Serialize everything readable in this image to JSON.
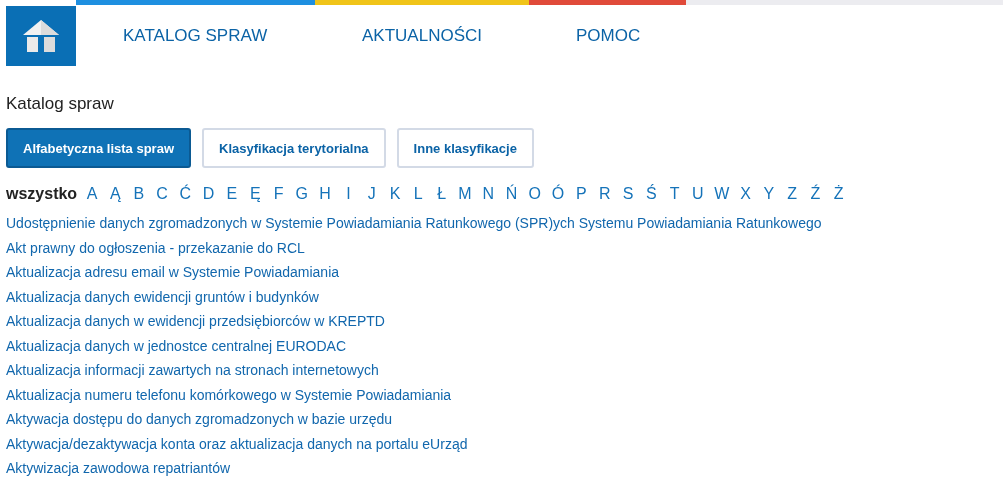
{
  "nav": [
    {
      "label": "KATALOG SPRAW"
    },
    {
      "label": "AKTUALNOŚCI"
    },
    {
      "label": "POMOC"
    }
  ],
  "top_stripes": [
    {
      "color": "#1e8fe0"
    },
    {
      "color": "#f0c419"
    },
    {
      "color": "#e04a3a"
    }
  ],
  "heading": "Katalog spraw",
  "tabs": [
    {
      "label": "Alfabetyczna lista spraw",
      "selected": true
    },
    {
      "label": "Klasyfikacja terytorialna",
      "selected": false
    },
    {
      "label": "Inne klasyfikacje",
      "selected": false
    }
  ],
  "letters": [
    {
      "label": "wszystko",
      "selected": true
    },
    {
      "label": "A",
      "selected": false
    },
    {
      "label": "Ą",
      "selected": false
    },
    {
      "label": "B",
      "selected": false
    },
    {
      "label": "C",
      "selected": false
    },
    {
      "label": "Ć",
      "selected": false
    },
    {
      "label": "D",
      "selected": false
    },
    {
      "label": "E",
      "selected": false
    },
    {
      "label": "Ę",
      "selected": false
    },
    {
      "label": "F",
      "selected": false
    },
    {
      "label": "G",
      "selected": false
    },
    {
      "label": "H",
      "selected": false
    },
    {
      "label": "I",
      "selected": false
    },
    {
      "label": "J",
      "selected": false
    },
    {
      "label": "K",
      "selected": false
    },
    {
      "label": "L",
      "selected": false
    },
    {
      "label": "Ł",
      "selected": false
    },
    {
      "label": "M",
      "selected": false
    },
    {
      "label": "N",
      "selected": false
    },
    {
      "label": "Ń",
      "selected": false
    },
    {
      "label": "O",
      "selected": false
    },
    {
      "label": "Ó",
      "selected": false
    },
    {
      "label": "P",
      "selected": false
    },
    {
      "label": "R",
      "selected": false
    },
    {
      "label": "S",
      "selected": false
    },
    {
      "label": "Ś",
      "selected": false
    },
    {
      "label": "T",
      "selected": false
    },
    {
      "label": "U",
      "selected": false
    },
    {
      "label": "W",
      "selected": false
    },
    {
      "label": "X",
      "selected": false
    },
    {
      "label": "Y",
      "selected": false
    },
    {
      "label": "Z",
      "selected": false
    },
    {
      "label": "Ź",
      "selected": false
    },
    {
      "label": "Ż",
      "selected": false
    }
  ],
  "cases": [
    "Udostępnienie danych zgromadzonych w Systemie Powiadamiania Ratunkowego (SPR)ych Systemu Powiadamiania Ratunkowego",
    "Akt prawny do ogłoszenia - przekazanie do RCL",
    "Aktualizacja adresu email w Systemie Powiadamiania",
    "Aktualizacja danych ewidencji gruntów i budynków",
    "Aktualizacja danych w ewidencji przedsiębiorców w KREPTD",
    "Aktualizacja danych w jednostce centralnej EURODAC",
    "Aktualizacja informacji zawartych na stronach internetowych",
    "Aktualizacja numeru telefonu komórkowego w Systemie Powiadamiania",
    "Aktywacja dostępu do danych zgromadzonych w bazie urzędu",
    "Aktywacja/dezaktywacja konta oraz aktualizacja danych na portalu eUrząd",
    "Aktywizacja zawodowa repatriantów"
  ]
}
